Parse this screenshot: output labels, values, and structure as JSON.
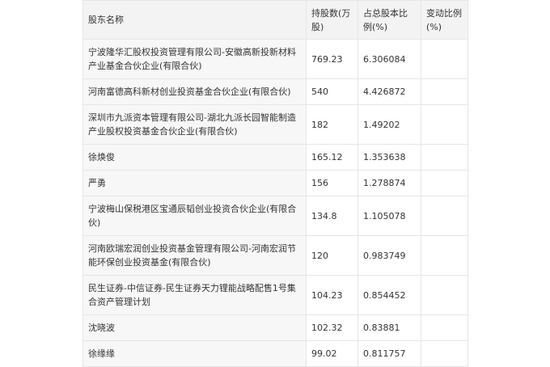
{
  "table": {
    "headers": [
      "股东名称",
      "持股数(万股)",
      "占总股本比例(%)",
      "变动比例(%)"
    ],
    "rows": [
      {
        "name": "宁波隆华汇股权投资管理有限公司-安徽高新投新材料产业基金合伙企业(有限合伙)",
        "shares": "769.23",
        "ratio": "6.306084",
        "change": ""
      },
      {
        "name": "河南富德高科新材创业投资基金合伙企业(有限合伙)",
        "shares": "540",
        "ratio": "4.426872",
        "change": ""
      },
      {
        "name": "深圳市九派资本管理有限公司-湖北九派长园智能制造产业股权投资基金合伙企业(有限合伙)",
        "shares": "182",
        "ratio": "1.49202",
        "change": ""
      },
      {
        "name": "徐焕俊",
        "shares": "165.12",
        "ratio": "1.353638",
        "change": ""
      },
      {
        "name": "严勇",
        "shares": "156",
        "ratio": "1.278874",
        "change": ""
      },
      {
        "name": "宁波梅山保税港区宝通辰韬创业投资合伙企业(有限合伙)",
        "shares": "134.8",
        "ratio": "1.105078",
        "change": ""
      },
      {
        "name": "河南欧瑞宏润创业投资基金管理有限公司-河南宏润节能环保创业投资基金(有限合伙)",
        "shares": "120",
        "ratio": "0.983749",
        "change": ""
      },
      {
        "name": "民生证券-中信证券-民生证券天力锂能战略配售1号集合资产管理计划",
        "shares": "104.23",
        "ratio": "0.854452",
        "change": ""
      },
      {
        "name": "沈晓波",
        "shares": "102.32",
        "ratio": "0.83881",
        "change": ""
      },
      {
        "name": "徐缘缘",
        "shares": "99.02",
        "ratio": "0.811757",
        "change": ""
      }
    ]
  }
}
